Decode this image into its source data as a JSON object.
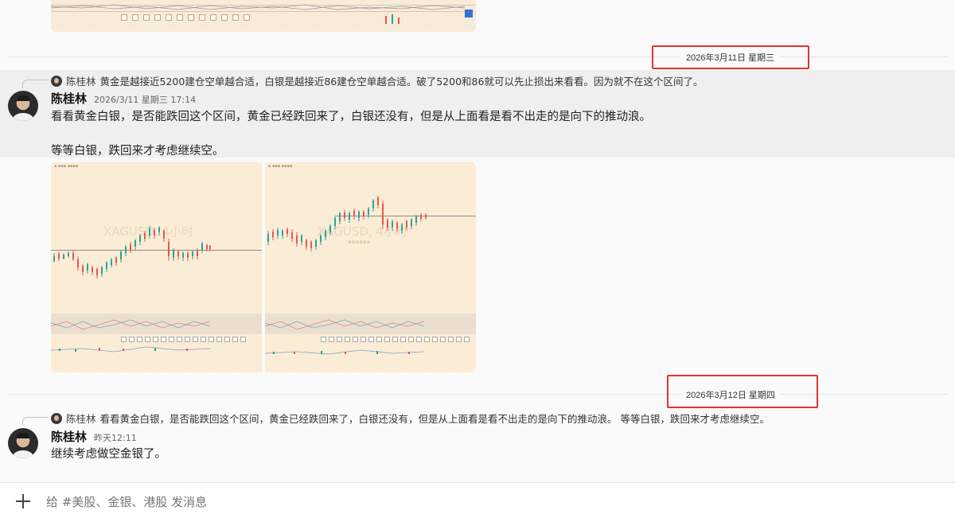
{
  "dates": {
    "first": "2026年3月11日 星期三",
    "second": "2026年3月12日 星期四"
  },
  "message1": {
    "reply": {
      "name": "陈桂林",
      "text": "黄金是越接近5200建仓空单越合适，白银是越接近86建仓空单越合适。破了5200和86就可以先止损出来看看。因为就不在这个区间了。"
    },
    "author": "陈桂林",
    "timestamp": "2026/3/11 星期三 17:14",
    "lines": [
      "看看黄金白银，是否能跌回这个区间，黄金已经跌回来了，白银还没有，但是从上面看是看不出走的是向下的推动浪。",
      "等等白银，跌回来才考虑继续空。"
    ],
    "images": [
      {
        "watermark": "XAGUSD, 4小时"
      },
      {
        "watermark": "XAGUSD, 4小时"
      }
    ]
  },
  "message2": {
    "reply": {
      "name": "陈桂林",
      "text": "看看黄金白银，是否能跌回这个区间，黄金已经跌回来了，白银还没有，但是从上面看是看不出走的是向下的推动浪。  等等白银，跌回来才考虑继续空。"
    },
    "author": "陈桂林",
    "timestamp": "昨天12:11",
    "lines": [
      "继续考虑做空金银了。"
    ]
  },
  "composer": {
    "placeholder": "给 #美股、金银、港股 发消息"
  },
  "icons": {
    "add": "plus-icon"
  },
  "colors": {
    "highlight_box": "#e3342f",
    "chart_bg": "#fbecd6",
    "candle_up": "#26a69a",
    "candle_down": "#ef5350"
  }
}
